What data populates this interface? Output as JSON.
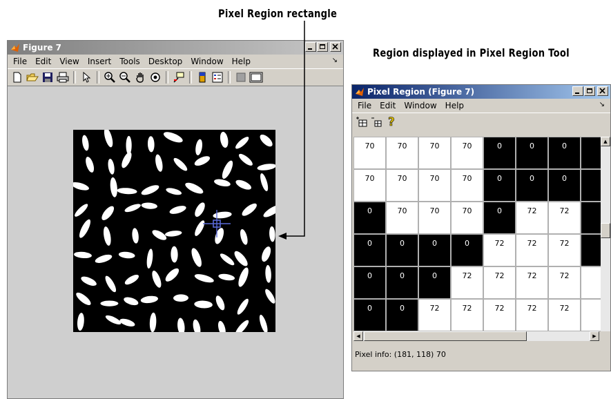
{
  "callouts": {
    "pixel_region_rectangle": "Pixel Region rectangle",
    "region_displayed": "Region displayed in Pixel Region Tool"
  },
  "figure_window": {
    "title": "Figure 7",
    "menu": [
      "File",
      "Edit",
      "View",
      "Insert",
      "Tools",
      "Desktop",
      "Window",
      "Help"
    ],
    "toolbar_icons": [
      "new-icon",
      "open-icon",
      "save-icon",
      "print-icon",
      "pointer-icon",
      "zoom-in-icon",
      "zoom-out-icon",
      "pan-icon",
      "rotate-icon",
      "data-cursor-icon",
      "colorbar-icon",
      "legend-icon",
      "hide-plot-tools-icon",
      "show-plot-tools-icon"
    ]
  },
  "pixel_region_window": {
    "title": "Pixel Region (Figure 7)",
    "menu": [
      "File",
      "Edit",
      "Window",
      "Help"
    ],
    "toolbar_icons": [
      "zoom-in-region-icon",
      "zoom-out-region-icon",
      "help-icon"
    ],
    "grid": {
      "rows": [
        [
          [
            "70",
            "w"
          ],
          [
            "70",
            "w"
          ],
          [
            "70",
            "w"
          ],
          [
            "70",
            "w"
          ],
          [
            "0",
            "b"
          ],
          [
            "0",
            "b"
          ],
          [
            "0",
            "b"
          ],
          [
            "",
            "b"
          ]
        ],
        [
          [
            "70",
            "w"
          ],
          [
            "70",
            "w"
          ],
          [
            "70",
            "w"
          ],
          [
            "70",
            "w"
          ],
          [
            "0",
            "b"
          ],
          [
            "0",
            "b"
          ],
          [
            "0",
            "b"
          ],
          [
            "",
            "b"
          ]
        ],
        [
          [
            "0",
            "b"
          ],
          [
            "70",
            "w"
          ],
          [
            "70",
            "w"
          ],
          [
            "70",
            "w"
          ],
          [
            "0",
            "b"
          ],
          [
            "72",
            "w"
          ],
          [
            "72",
            "w"
          ],
          [
            "",
            "b"
          ]
        ],
        [
          [
            "0",
            "b"
          ],
          [
            "0",
            "b"
          ],
          [
            "0",
            "b"
          ],
          [
            "0",
            "b"
          ],
          [
            "72",
            "w"
          ],
          [
            "72",
            "w"
          ],
          [
            "72",
            "w"
          ],
          [
            "",
            "b"
          ]
        ],
        [
          [
            "0",
            "b"
          ],
          [
            "0",
            "b"
          ],
          [
            "0",
            "b"
          ],
          [
            "72",
            "w"
          ],
          [
            "72",
            "w"
          ],
          [
            "72",
            "w"
          ],
          [
            "72",
            "w"
          ],
          [
            "",
            "w"
          ]
        ],
        [
          [
            "0",
            "b"
          ],
          [
            "0",
            "b"
          ],
          [
            "72",
            "w"
          ],
          [
            "72",
            "w"
          ],
          [
            "72",
            "w"
          ],
          [
            "72",
            "w"
          ],
          [
            "72",
            "w"
          ],
          [
            "",
            "w"
          ]
        ]
      ]
    },
    "status_text": "Pixel info: (181, 118)  70"
  }
}
